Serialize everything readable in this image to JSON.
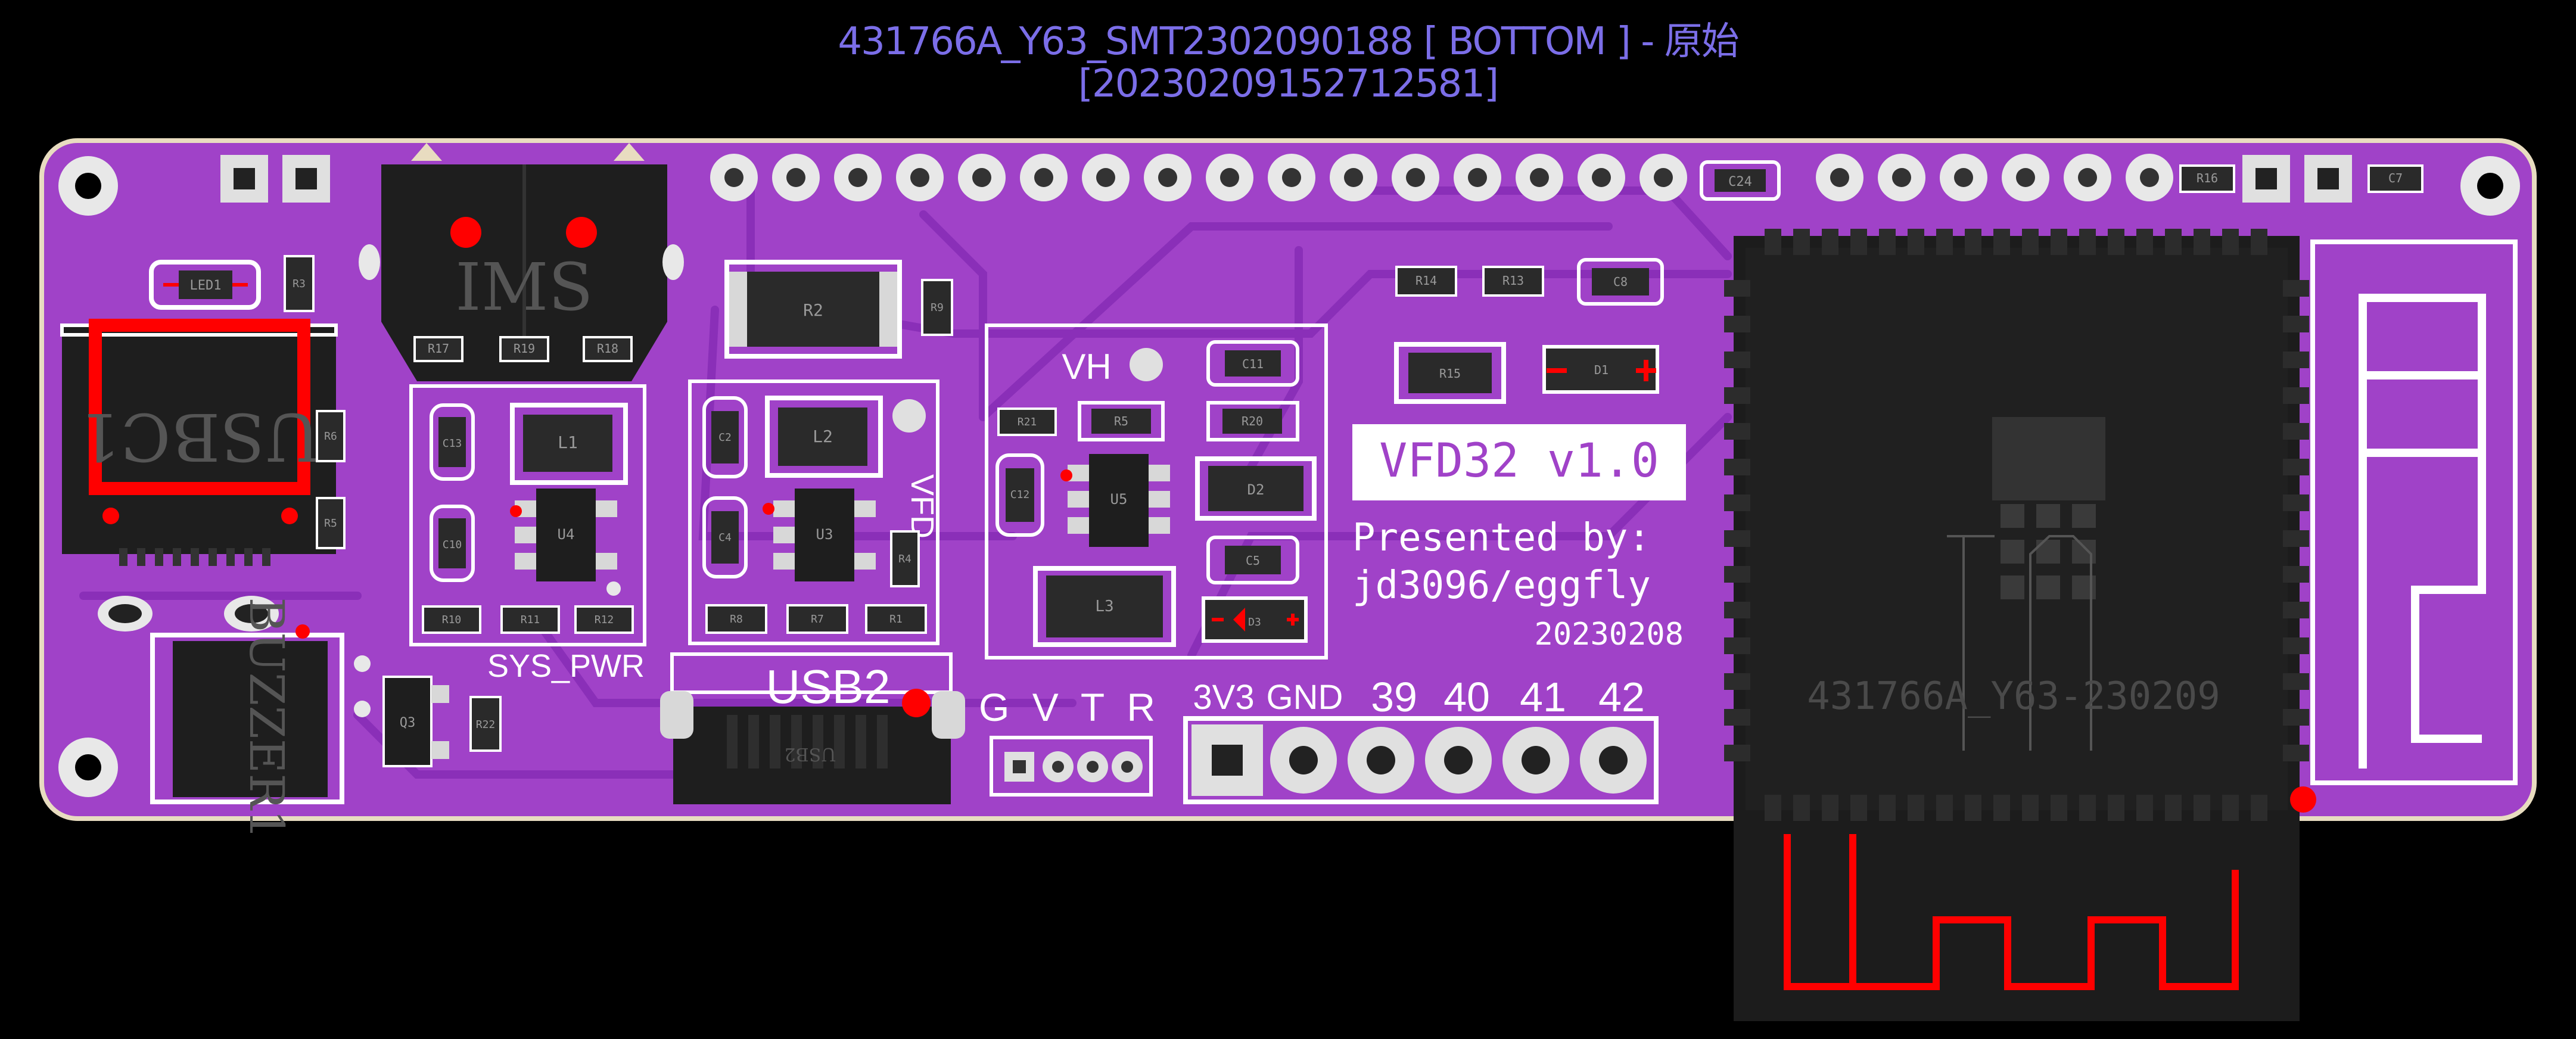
{
  "header": {
    "title_line1": "431766A_Y63_SMT2302090188 [ BOTTOM ] - 原始",
    "title_line2": "[20230209152712581]"
  },
  "silkscreen": {
    "ims": "IMS",
    "usbc1": "USBC1",
    "buzzer": "BUZZER1",
    "sys_pwr": "SYS_PWR",
    "usb2": "USB2",
    "usb2_part": "USB2",
    "vh": "VH",
    "vfd": "VFD",
    "gvtr": "G V T R",
    "vfd32": "VFD32 v1.0",
    "presented_by": "Presented by:",
    "author": "jd3096/eggfly",
    "date": "20230208",
    "module_marking": "431766A_Y63-230209",
    "pin_labels": [
      "3V3",
      "GND",
      "39",
      "40",
      "41",
      "42"
    ]
  },
  "parts": {
    "led1": "LED1",
    "r3": "R3",
    "r6": "R6",
    "r5b": "R5",
    "r17": "R17",
    "r19": "R19",
    "r18": "R18",
    "r2": "R2",
    "r9": "R9",
    "l1": "L1",
    "u4": "U4",
    "c13": "C13",
    "c10": "C10",
    "r10": "R10",
    "r11": "R11",
    "r12": "R12",
    "c2": "C2",
    "l2": "L2",
    "c4": "C4",
    "u3": "U3",
    "r4": "R4",
    "r8": "R8",
    "r7": "R7",
    "r1": "R1",
    "c11": "C11",
    "r21": "R21",
    "r5": "R5",
    "r20": "R20",
    "u5": "U5",
    "c12": "C12",
    "d2": "D2",
    "l3": "L3",
    "c5": "C5",
    "d3": "D3",
    "r14": "R14",
    "r13": "R13",
    "c8": "C8",
    "r15": "R15",
    "d1": "D1",
    "c24": "C24",
    "r16": "R16",
    "c7": "C7",
    "q3": "Q3",
    "r22": "R22"
  },
  "colors": {
    "board": "#a042c8",
    "board_edge": "#e8dcc0",
    "trace": "#8a2fb8",
    "silk": "#ffffff",
    "pad": "#d8d8d8",
    "copper_top": "#ff0000",
    "module": "#1a1a1a",
    "title": "#7b6ee8"
  }
}
